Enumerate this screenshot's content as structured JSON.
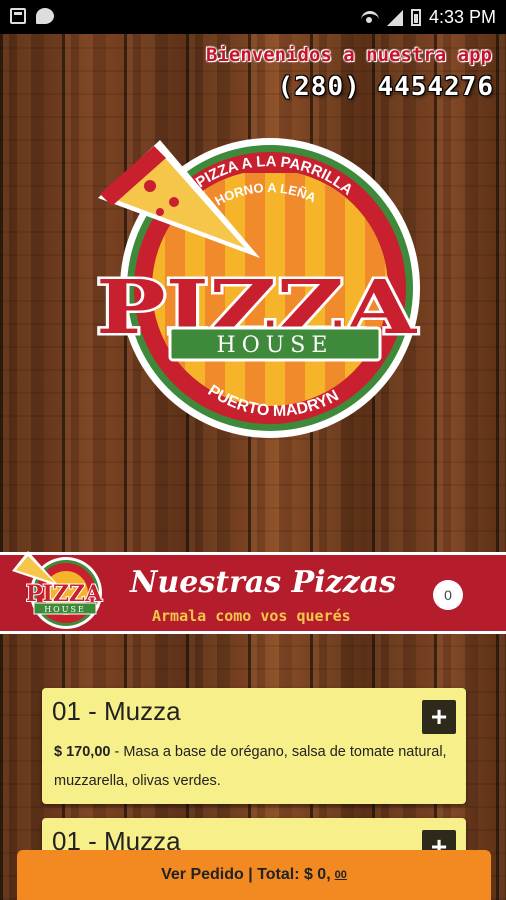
{
  "status_bar": {
    "time": "4:33 PM"
  },
  "header": {
    "welcome": "Bienvenidos a nuestra app",
    "phone": "(280) 4454276"
  },
  "logo": {
    "top_text_1": "PIZZA A LA PARRILLA",
    "top_text_2": "HORNO A LEÑA",
    "brand": "PIZZA",
    "brand_sub": "HOUSE",
    "location": "PUERTO MADRYN"
  },
  "banner": {
    "title": "Nuestras Pizzas",
    "subtitle": "Armala como vos querés",
    "cart_count": "0"
  },
  "products": [
    {
      "title": "01 - Muzza",
      "price": "$ 170,00",
      "description": " - Masa a base de orégano, salsa de tomate natural, muzzarella, olivas verdes.",
      "add_label": "+"
    },
    {
      "title": "01 - Muzza",
      "add_label": "+"
    }
  ],
  "order_bar": {
    "label": "Ver Pedido | Total: $ 0,",
    "cents": "00"
  },
  "colors": {
    "banner_red": "#b51d2d",
    "card_yellow": "#f7ef8a",
    "order_orange": "#f28a21",
    "logo_green": "#3e8a3a"
  }
}
